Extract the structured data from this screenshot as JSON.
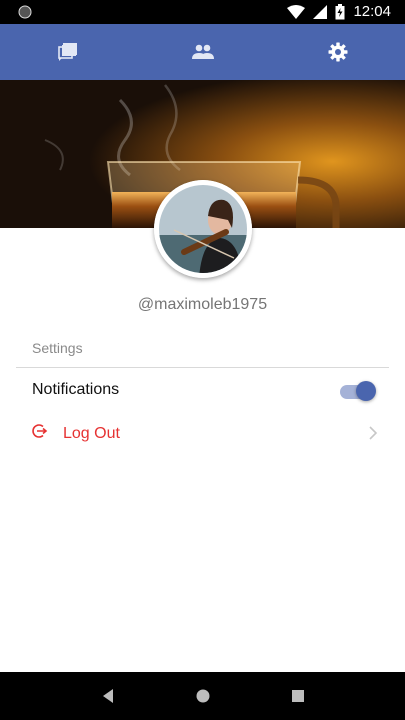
{
  "status_bar": {
    "time": "12:04"
  },
  "tabs": [
    {
      "icon": "chat-icon",
      "selected": false
    },
    {
      "icon": "people-icon",
      "selected": false
    },
    {
      "icon": "gear-icon",
      "selected": true
    }
  ],
  "profile": {
    "username": "@maximoleb1975"
  },
  "settings": {
    "section_label": "Settings",
    "notifications_label": "Notifications",
    "notifications_on": true,
    "logout_label": "Log Out"
  },
  "colors": {
    "primary": "#4a65ae",
    "danger": "#e63232"
  }
}
